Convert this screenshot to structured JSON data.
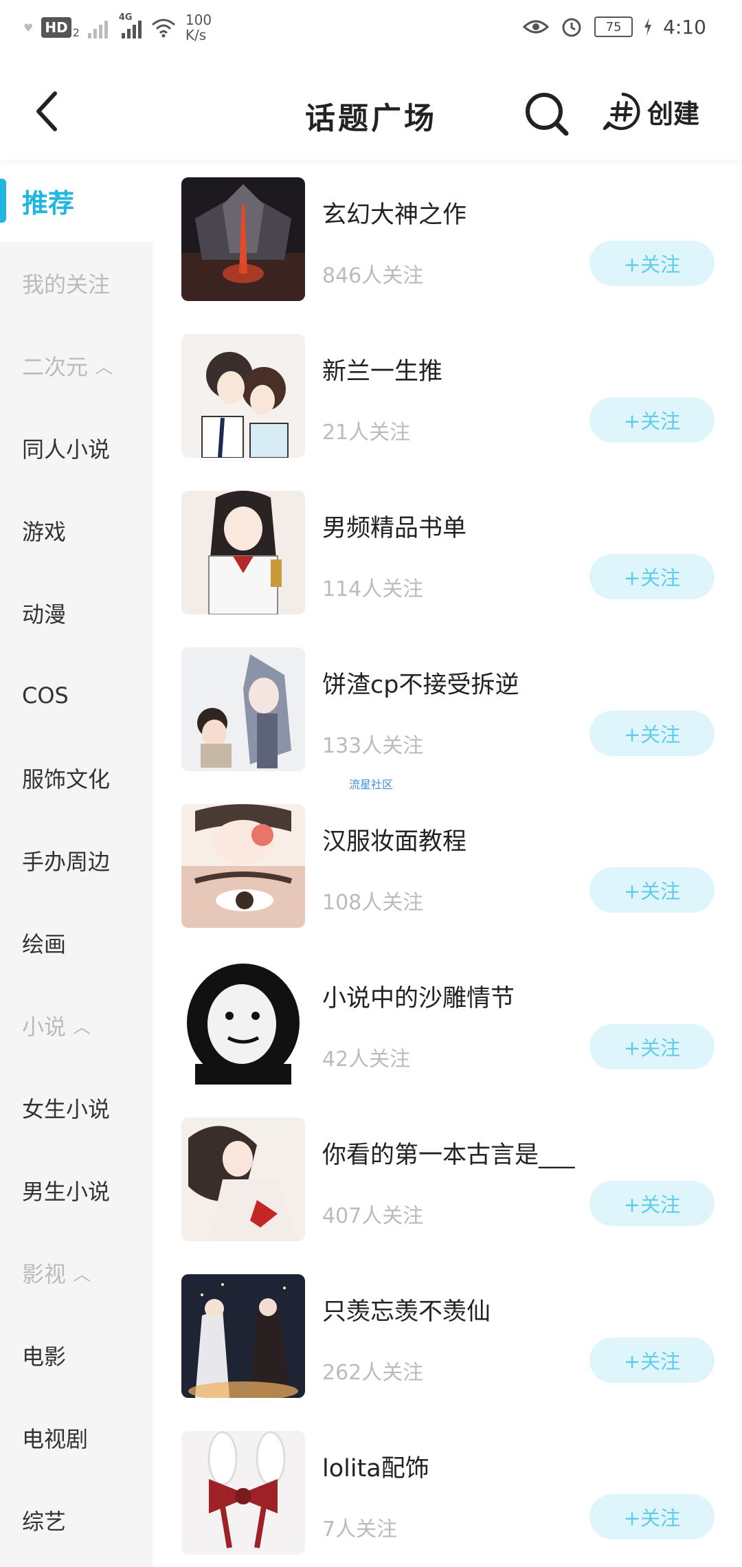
{
  "status_bar": {
    "hd_label": "HD",
    "hd_sub": "2",
    "network_tag": "4G",
    "speed_value": "100",
    "speed_unit": "K/s",
    "battery": "75",
    "time": "4:10"
  },
  "header": {
    "title": "话题广场",
    "create_label": "创建"
  },
  "sidebar": {
    "items": [
      {
        "label": "推荐",
        "kind": "active"
      },
      {
        "label": "我的关注",
        "kind": "muted"
      },
      {
        "label": "二次元",
        "kind": "group"
      },
      {
        "label": "同人小说",
        "kind": "normal"
      },
      {
        "label": "游戏",
        "kind": "normal"
      },
      {
        "label": "动漫",
        "kind": "normal"
      },
      {
        "label": "COS",
        "kind": "normal"
      },
      {
        "label": "服饰文化",
        "kind": "normal"
      },
      {
        "label": "手办周边",
        "kind": "normal"
      },
      {
        "label": "绘画",
        "kind": "normal"
      },
      {
        "label": "小说",
        "kind": "group"
      },
      {
        "label": "女生小说",
        "kind": "normal"
      },
      {
        "label": "男生小说",
        "kind": "normal"
      },
      {
        "label": "影视",
        "kind": "group"
      },
      {
        "label": "电影",
        "kind": "normal"
      },
      {
        "label": "电视剧",
        "kind": "normal"
      },
      {
        "label": "综艺",
        "kind": "normal"
      }
    ]
  },
  "topics": [
    {
      "name": "玄幻大神之作",
      "followers": "846人关注",
      "follow_label": "+关注"
    },
    {
      "name": "新兰一生推",
      "followers": "21人关注",
      "follow_label": "+关注"
    },
    {
      "name": "男频精品书单",
      "followers": "114人关注",
      "follow_label": "+关注"
    },
    {
      "name": "饼渣cp不接受拆逆",
      "followers": "133人关注",
      "follow_label": "+关注"
    },
    {
      "name": "汉服妆面教程",
      "followers": "108人关注",
      "follow_label": "+关注"
    },
    {
      "name": "小说中的沙雕情节",
      "followers": "42人关注",
      "follow_label": "+关注"
    },
    {
      "name": "你看的第一本古言是___",
      "followers": "407人关注",
      "follow_label": "+关注"
    },
    {
      "name": "只羡忘羡不羡仙",
      "followers": "262人关注",
      "follow_label": "+关注"
    },
    {
      "name": "lolita配饰",
      "followers": "7人关注",
      "follow_label": "+关注"
    }
  ],
  "watermark": "流星社区",
  "colors": {
    "accent": "#1fb6e0",
    "follow_bg": "#dff5fc",
    "follow_text": "#5fcde9",
    "muted_text": "#bbbbbb"
  }
}
